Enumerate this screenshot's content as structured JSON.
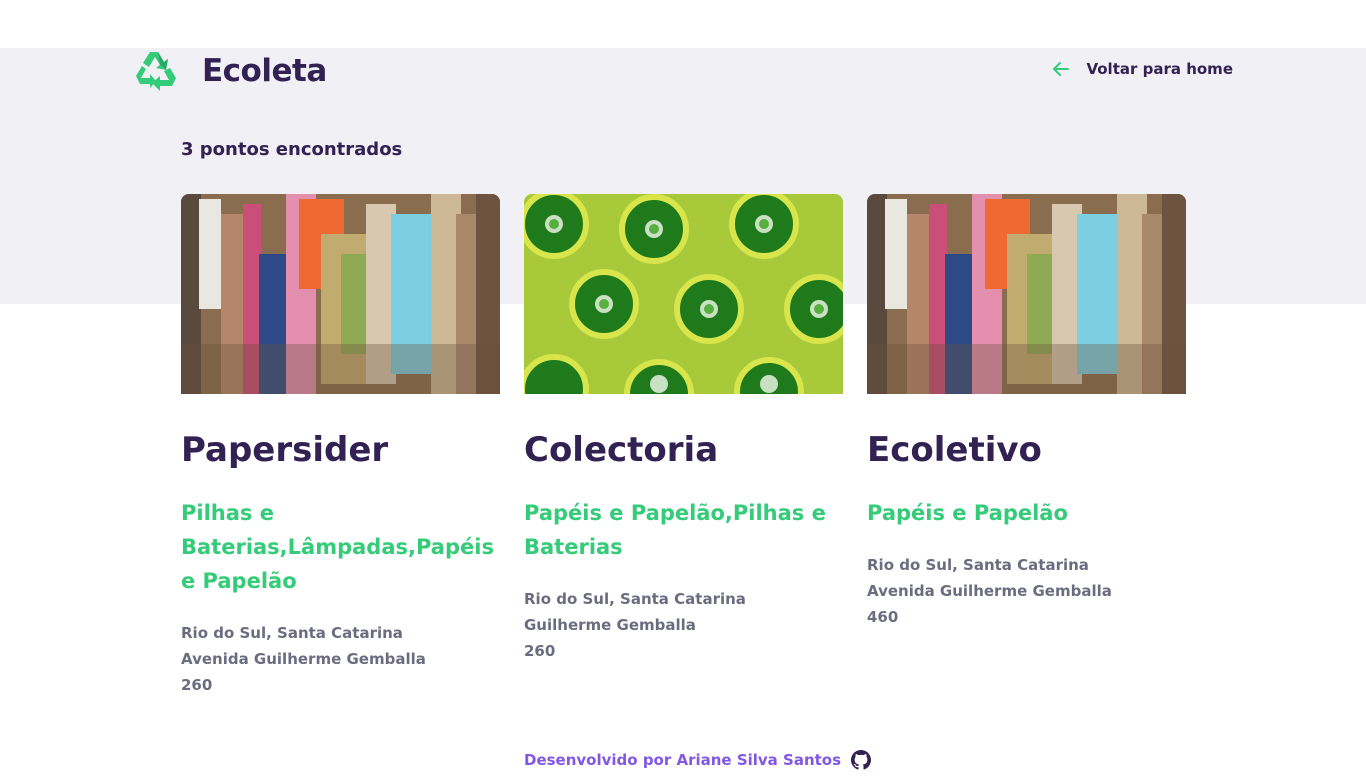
{
  "app": {
    "name": "Ecoleta",
    "colors": {
      "primary": "#34cb79",
      "title": "#322153",
      "text": "#6c6c80",
      "accent": "#8257e5",
      "band": "#f0f0f5"
    }
  },
  "header": {
    "logo_icon": "recycle-icon",
    "back_icon": "arrow-left-icon",
    "back_label": "Voltar para home"
  },
  "results": {
    "count_text": "3 pontos encontrados"
  },
  "points": [
    {
      "image": "paper-bale-photo",
      "name": "Papersider",
      "items": "Pilhas e Baterias,Lâmpadas,Papéis e Papelão",
      "city": "Rio do Sul, Santa Catarina",
      "street": "Avenida Guilherme Gemballa",
      "number": "260"
    },
    {
      "image": "glass-bottles-photo",
      "name": "Colectoria",
      "items": "Papéis e Papelão,Pilhas e Baterias",
      "city": "Rio do Sul, Santa Catarina",
      "street": "Guilherme Gemballa",
      "number": "260"
    },
    {
      "image": "paper-bale-photo",
      "name": "Ecoletivo",
      "items": "Papéis e Papelão",
      "city": "Rio do Sul, Santa Catarina",
      "street": "Avenida Guilherme Gemballa",
      "number": "460"
    }
  ],
  "footer": {
    "text": "Desenvolvido por Ariane Silva Santos",
    "icon": "github-icon"
  }
}
